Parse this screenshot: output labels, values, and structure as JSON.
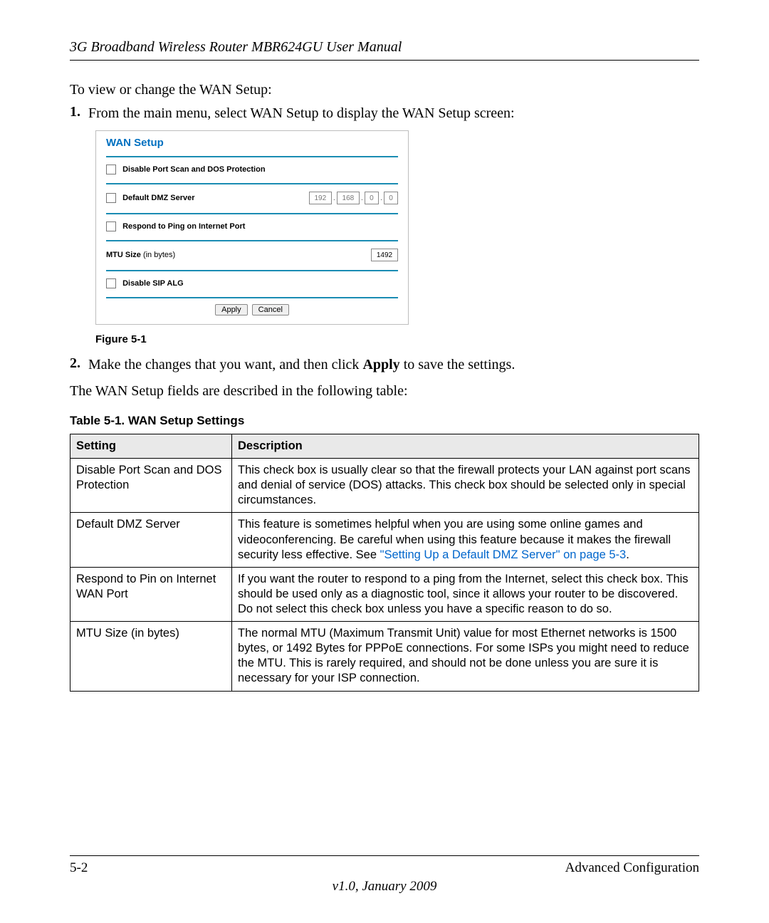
{
  "header": {
    "running_head": "3G Broadband Wireless Router MBR624GU User Manual"
  },
  "intro": "To view or change the WAN Setup:",
  "steps": {
    "s1_num": "1.",
    "s1_text": "From the main menu, select WAN Setup to display the WAN Setup screen:",
    "s2_num": "2.",
    "s2_pre": "Make the changes that you want, and then click ",
    "s2_bold": "Apply",
    "s2_post": " to save the settings."
  },
  "figure": {
    "title": "WAN Setup",
    "row_dos": "Disable Port Scan and DOS Protection",
    "row_dmz": "Default DMZ Server",
    "ip": {
      "a": "192",
      "b": "168",
      "c": "0",
      "d": "0"
    },
    "row_ping": "Respond to Ping on Internet Port",
    "row_mtu_label": "MTU Size ",
    "row_mtu_sub": "(in bytes)",
    "mtu_value": "1492",
    "row_sip": "Disable SIP ALG",
    "btn_apply": "Apply",
    "btn_cancel": "Cancel",
    "caption": "Figure 5-1"
  },
  "after_fig": "The WAN Setup fields are described in the following table:",
  "table_title": "Table 5-1.  WAN Setup Settings",
  "table": {
    "h_setting": "Setting",
    "h_desc": "Description",
    "rows": [
      {
        "setting": "Disable Port Scan and DOS Protection",
        "desc": "This check box is usually clear so that the firewall protects your LAN against port scans and denial of service (DOS) attacks. This check box should be selected only in special circumstances."
      },
      {
        "setting": "Default DMZ Server",
        "desc_pre": "This feature is sometimes helpful when you are using some online games and videoconferencing. Be careful when using this feature because it makes the firewall security less effective. See ",
        "desc_link": "\"Setting Up a Default DMZ Server\" on page 5-3",
        "desc_post": "."
      },
      {
        "setting": "Respond to Pin on Internet WAN Port",
        "desc": "If you want the router to respond to a ping from the Internet, select this check box. This should be used only as a diagnostic tool, since it allows your router to be discovered. Do not select this check box unless you have a specific reason to do so."
      },
      {
        "setting": "MTU Size (in bytes)",
        "desc": "The normal MTU (Maximum Transmit Unit) value for most Ethernet networks is 1500 bytes, or 1492 Bytes for PPPoE connections. For some ISPs you might need to reduce the MTU. This is rarely required, and should not be done unless you are sure it is necessary for your ISP connection."
      }
    ]
  },
  "footer": {
    "page": "5-2",
    "section": "Advanced Configuration",
    "version": "v1.0, January 2009"
  }
}
